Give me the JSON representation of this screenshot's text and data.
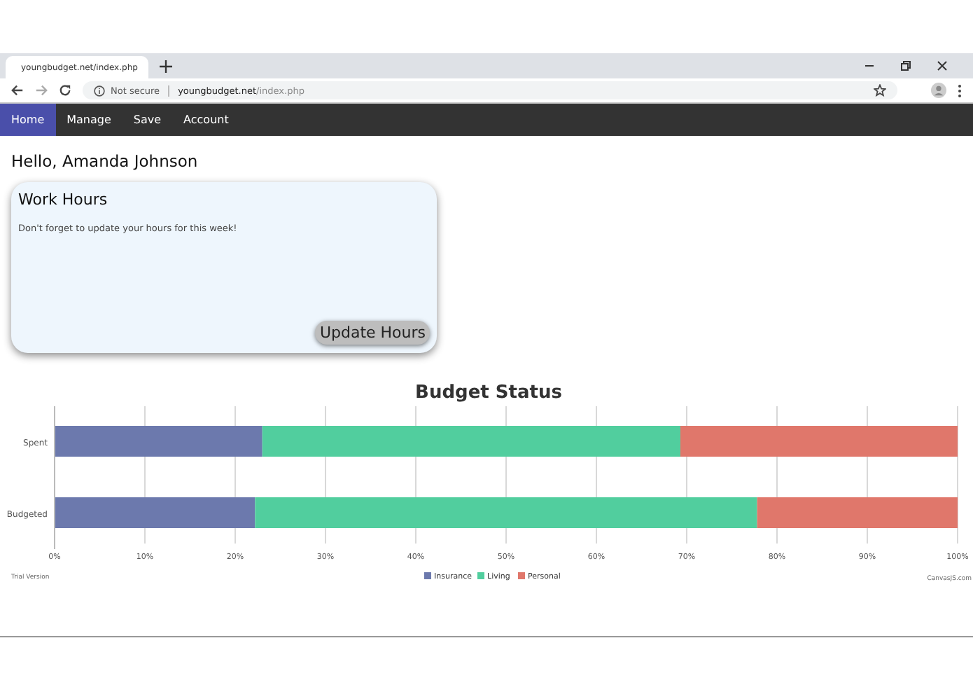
{
  "browser": {
    "tab_title": "youngbudget.net/index.php",
    "security": "Not secure",
    "url_host": "youngbudget.net",
    "url_path": "/index.php"
  },
  "nav": [
    {
      "label": "Home",
      "selected": true
    },
    {
      "label": "Manage",
      "selected": false
    },
    {
      "label": "Save",
      "selected": false
    },
    {
      "label": "Account",
      "selected": false
    }
  ],
  "greeting": "Hello, Amanda Johnson",
  "card": {
    "title": "Work Hours",
    "message": "Don't forget to update your hours for this week!",
    "button": "Update Hours"
  },
  "chart": {
    "chart_data": {
      "type": "bar",
      "orientation": "horizontal",
      "stacked": true,
      "title": "Budget Status",
      "categories": [
        "Spent",
        "Budgeted"
      ],
      "series": [
        {
          "name": "Insurance",
          "color": "#6c79ad",
          "values": [
            23,
            22.2
          ]
        },
        {
          "name": "Living",
          "color": "#51ce9e",
          "values": [
            46.3,
            55.6
          ]
        },
        {
          "name": "Personal",
          "color": "#e0776b",
          "values": [
            30.7,
            22.2
          ]
        }
      ],
      "xlim": [
        0,
        100
      ],
      "grid": true,
      "legend": "bottom",
      "xticks": [
        {
          "value": 0,
          "label": "0%"
        },
        {
          "value": 10,
          "label": "10%"
        },
        {
          "value": 20,
          "label": "20%"
        },
        {
          "value": 30,
          "label": "30%"
        },
        {
          "value": 40,
          "label": "40%"
        },
        {
          "value": 50,
          "label": "50%"
        },
        {
          "value": 60,
          "label": "60%"
        },
        {
          "value": 70,
          "label": "70%"
        },
        {
          "value": 80,
          "label": "80%"
        },
        {
          "value": 90,
          "label": "90%"
        },
        {
          "value": 100,
          "label": "100%"
        }
      ]
    },
    "trial_note": "Trial Version",
    "credit": "CanvasJS.com"
  }
}
